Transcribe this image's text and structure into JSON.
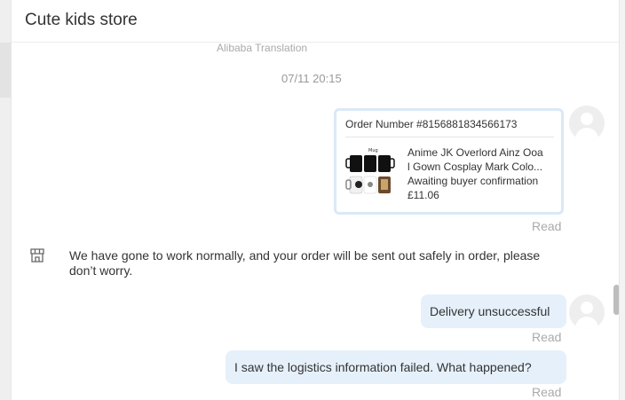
{
  "header": {
    "title": "Cute kids store"
  },
  "chat": {
    "translation_note": "Alibaba Translation",
    "timestamp": "07/11 20:15",
    "order_card": {
      "order_number": "Order Number #8156881834566173",
      "product_line1": "Anime JK Overlord Ainz Ooa",
      "product_line2": "l Gown Cosplay Mark Colo...",
      "status": "Awaiting buyer confirmation",
      "price": "£11.06"
    },
    "read_label": "Read",
    "seller_message": "We have gone to work normally, and your order will be sent out safely in order, please don’t worry.",
    "buyer_messages": [
      "Delivery unsuccessful",
      "I saw the logistics information failed. What happened?"
    ]
  },
  "icons": {
    "avatar": "user-avatar-icon",
    "store": "store-icon"
  },
  "colors": {
    "bubble": "#e6f0fb",
    "card_border": "#dbe8f7",
    "read": "#aaaaaa"
  }
}
